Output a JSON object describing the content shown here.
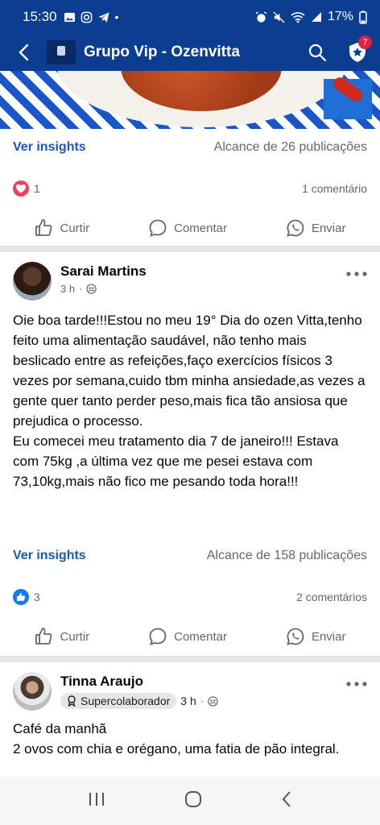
{
  "status": {
    "time": "15:30",
    "battery": "17%"
  },
  "appbar": {
    "title": "Grupo Vip - Ozenvitta",
    "notif_count": "7"
  },
  "post1": {
    "insights_label": "Ver insights",
    "reach": "Alcance de 26 publicações",
    "reaction_count": "1",
    "comments": "1 comentário",
    "like_label": "Curtir",
    "comment_label": "Comentar",
    "share_label": "Enviar"
  },
  "post2": {
    "author": "Sarai Martins",
    "time": "3 h",
    "text": "Oie boa tarde!!!Estou no meu 19° Dia do ozen Vitta,tenho feito uma alimentação saudável, não tenho mais beslicado entre as refeições,faço exercícios físicos 3 vezes por semana,cuido tbm minha ansiedade,as vezes a gente quer tanto perder peso,mais fica tão ansiosa que prejudica o processo.\nEu comecei meu tratamento dia 7 de janeiro!!! Estava com 75kg ,a última vez que me pesei estava com 73,10kg,mais não fico me pesando toda hora!!!",
    "insights_label": "Ver insights",
    "reach": "Alcance de 158 publicações",
    "reaction_count": "3",
    "comments": "2 comentários",
    "like_label": "Curtir",
    "comment_label": "Comentar",
    "share_label": "Enviar"
  },
  "post3": {
    "author": "Tinna Araujo",
    "badge": "Supercolaborador",
    "time": "3 h",
    "text": "Café da manhã\n2 ovos com chia e orégano, uma fatia de pão integral."
  },
  "icons": {
    "back": "back-arrow-icon",
    "search": "search-icon",
    "shield": "shield-star-icon",
    "like": "thumbs-up-icon",
    "comment": "comment-bubble-icon",
    "share": "whatsapp-icon",
    "globe": "group-members-icon",
    "more": "more-dots-icon"
  }
}
